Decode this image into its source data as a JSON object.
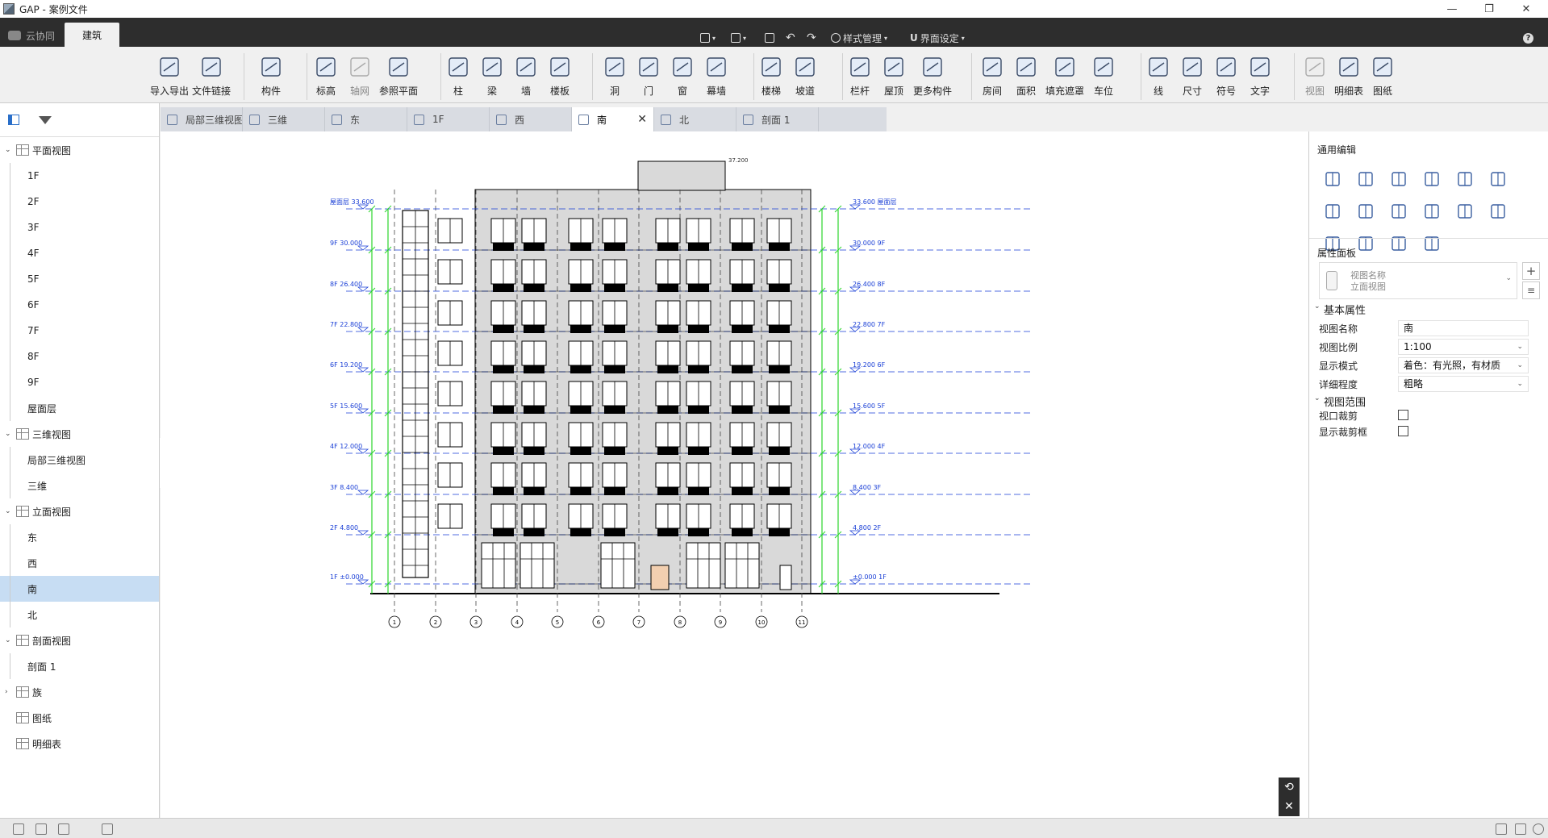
{
  "window": {
    "title": "GAP - 案例文件",
    "min": "—",
    "restore": "❐",
    "close": "✕"
  },
  "menubar": {
    "cloud_tab": "云协同",
    "arch_tab": "建筑",
    "style_manage": "样式管理",
    "ui_settings": "界面设定",
    "help": "?"
  },
  "ribbon": {
    "items": [
      {
        "label": "导入导出",
        "icon": "cad-import-icon"
      },
      {
        "label": "文件链接",
        "icon": "file-link-icon"
      },
      {
        "label": "构件",
        "icon": "component-icon"
      },
      {
        "label": "标高",
        "icon": "level-icon"
      },
      {
        "label": "轴网",
        "icon": "grid-icon",
        "disabled": true
      },
      {
        "label": "参照平面",
        "icon": "reference-plane-icon"
      },
      {
        "label": "柱",
        "icon": "column-icon"
      },
      {
        "label": "梁",
        "icon": "beam-icon"
      },
      {
        "label": "墙",
        "icon": "wall-icon"
      },
      {
        "label": "楼板",
        "icon": "floor-slab-icon"
      },
      {
        "label": "洞",
        "icon": "opening-icon"
      },
      {
        "label": "门",
        "icon": "door-icon"
      },
      {
        "label": "窗",
        "icon": "window-icon"
      },
      {
        "label": "幕墙",
        "icon": "curtain-wall-icon"
      },
      {
        "label": "楼梯",
        "icon": "stair-icon"
      },
      {
        "label": "坡道",
        "icon": "ramp-icon"
      },
      {
        "label": "栏杆",
        "icon": "railing-icon"
      },
      {
        "label": "屋顶",
        "icon": "roof-icon"
      },
      {
        "label": "更多构件",
        "icon": "more-components-icon"
      },
      {
        "label": "房间",
        "icon": "room-icon"
      },
      {
        "label": "面积",
        "icon": "area-icon"
      },
      {
        "label": "填充遮罩",
        "icon": "fill-mask-icon"
      },
      {
        "label": "车位",
        "icon": "parking-icon"
      },
      {
        "label": "线",
        "icon": "line-icon"
      },
      {
        "label": "尺寸",
        "icon": "dimension-icon"
      },
      {
        "label": "符号",
        "icon": "symbol-icon"
      },
      {
        "label": "文字",
        "icon": "text-icon"
      },
      {
        "label": "视图",
        "icon": "view-icon",
        "disabled": true
      },
      {
        "label": "明细表",
        "icon": "schedule-icon"
      },
      {
        "label": "图纸",
        "icon": "sheet-icon"
      }
    ]
  },
  "tree": {
    "items": [
      {
        "label": "平面视图",
        "level": 0,
        "expanded": true
      },
      {
        "label": "1F",
        "level": 1
      },
      {
        "label": "2F",
        "level": 1
      },
      {
        "label": "3F",
        "level": 1
      },
      {
        "label": "4F",
        "level": 1
      },
      {
        "label": "5F",
        "level": 1
      },
      {
        "label": "6F",
        "level": 1
      },
      {
        "label": "7F",
        "level": 1
      },
      {
        "label": "8F",
        "level": 1
      },
      {
        "label": "9F",
        "level": 1
      },
      {
        "label": "屋面层",
        "level": 1
      },
      {
        "label": "三维视图",
        "level": 0,
        "expanded": true
      },
      {
        "label": "局部三维视图",
        "level": 1
      },
      {
        "label": "三维",
        "level": 1
      },
      {
        "label": "立面视图",
        "level": 0,
        "expanded": true
      },
      {
        "label": "东",
        "level": 1
      },
      {
        "label": "西",
        "level": 1
      },
      {
        "label": "南",
        "level": 1,
        "selected": true
      },
      {
        "label": "北",
        "level": 1
      },
      {
        "label": "剖面视图",
        "level": 0,
        "expanded": true
      },
      {
        "label": "剖面 1",
        "level": 1
      },
      {
        "label": "族",
        "level": 0,
        "expanded": false
      },
      {
        "label": "图纸",
        "level": 0
      },
      {
        "label": "明细表",
        "level": 0
      }
    ]
  },
  "tabs": [
    {
      "label": "局部三维视图"
    },
    {
      "label": "三维"
    },
    {
      "label": "东"
    },
    {
      "label": "1F"
    },
    {
      "label": "西"
    },
    {
      "label": "南",
      "active": true
    },
    {
      "label": "北"
    },
    {
      "label": "剖面 1"
    }
  ],
  "drawing": {
    "levels": [
      {
        "name": "屋面层",
        "elev": "33.600"
      },
      {
        "name": "9F",
        "elev": "30.000"
      },
      {
        "name": "8F",
        "elev": "26.400"
      },
      {
        "name": "7F",
        "elev": "22.800"
      },
      {
        "name": "6F",
        "elev": "19.200"
      },
      {
        "name": "5F",
        "elev": "15.600"
      },
      {
        "name": "4F",
        "elev": "12.000"
      },
      {
        "name": "3F",
        "elev": "8.400"
      },
      {
        "name": "2F",
        "elev": "4.800"
      },
      {
        "name": "1F",
        "elev": "±0.000"
      }
    ],
    "top_elev": "37.200",
    "grid_labels": [
      "1",
      "2",
      "3",
      "4",
      "5",
      "6",
      "7",
      "8",
      "9",
      "10",
      "11"
    ],
    "colors": {
      "level": "#1a3fd6",
      "dim": "#2bd62b",
      "wall": "#d9d9d9",
      "line": "#000000",
      "door": "#f2cfb0"
    }
  },
  "right": {
    "edit_title": "通用编辑",
    "edit_icons": [
      "move-icon",
      "copy-icon",
      "rotate-icon",
      "trim-icon",
      "split-icon",
      "extend-icon",
      "offset-icon",
      "align-icon",
      "break-icon",
      "array-icon",
      "mirror-icon",
      "pin-icon",
      "delete-icon",
      "scale-icon",
      "match-icon",
      "measure-icon"
    ],
    "props_title": "属性面板",
    "type_label": "视图名称",
    "type_sub": "立面视图",
    "sec_basic": "基本属性",
    "rows": [
      {
        "label": "视图名称",
        "value": "南",
        "dd": false
      },
      {
        "label": "视图比例",
        "value": "1:100",
        "dd": true
      },
      {
        "label": "显示模式",
        "value": "着色：有光照，有材质",
        "dd": true
      },
      {
        "label": "详细程度",
        "value": "粗略",
        "dd": true
      }
    ],
    "sec_range": "视图范围",
    "checks": [
      {
        "label": "视口裁剪"
      },
      {
        "label": "显示裁剪框"
      }
    ]
  }
}
